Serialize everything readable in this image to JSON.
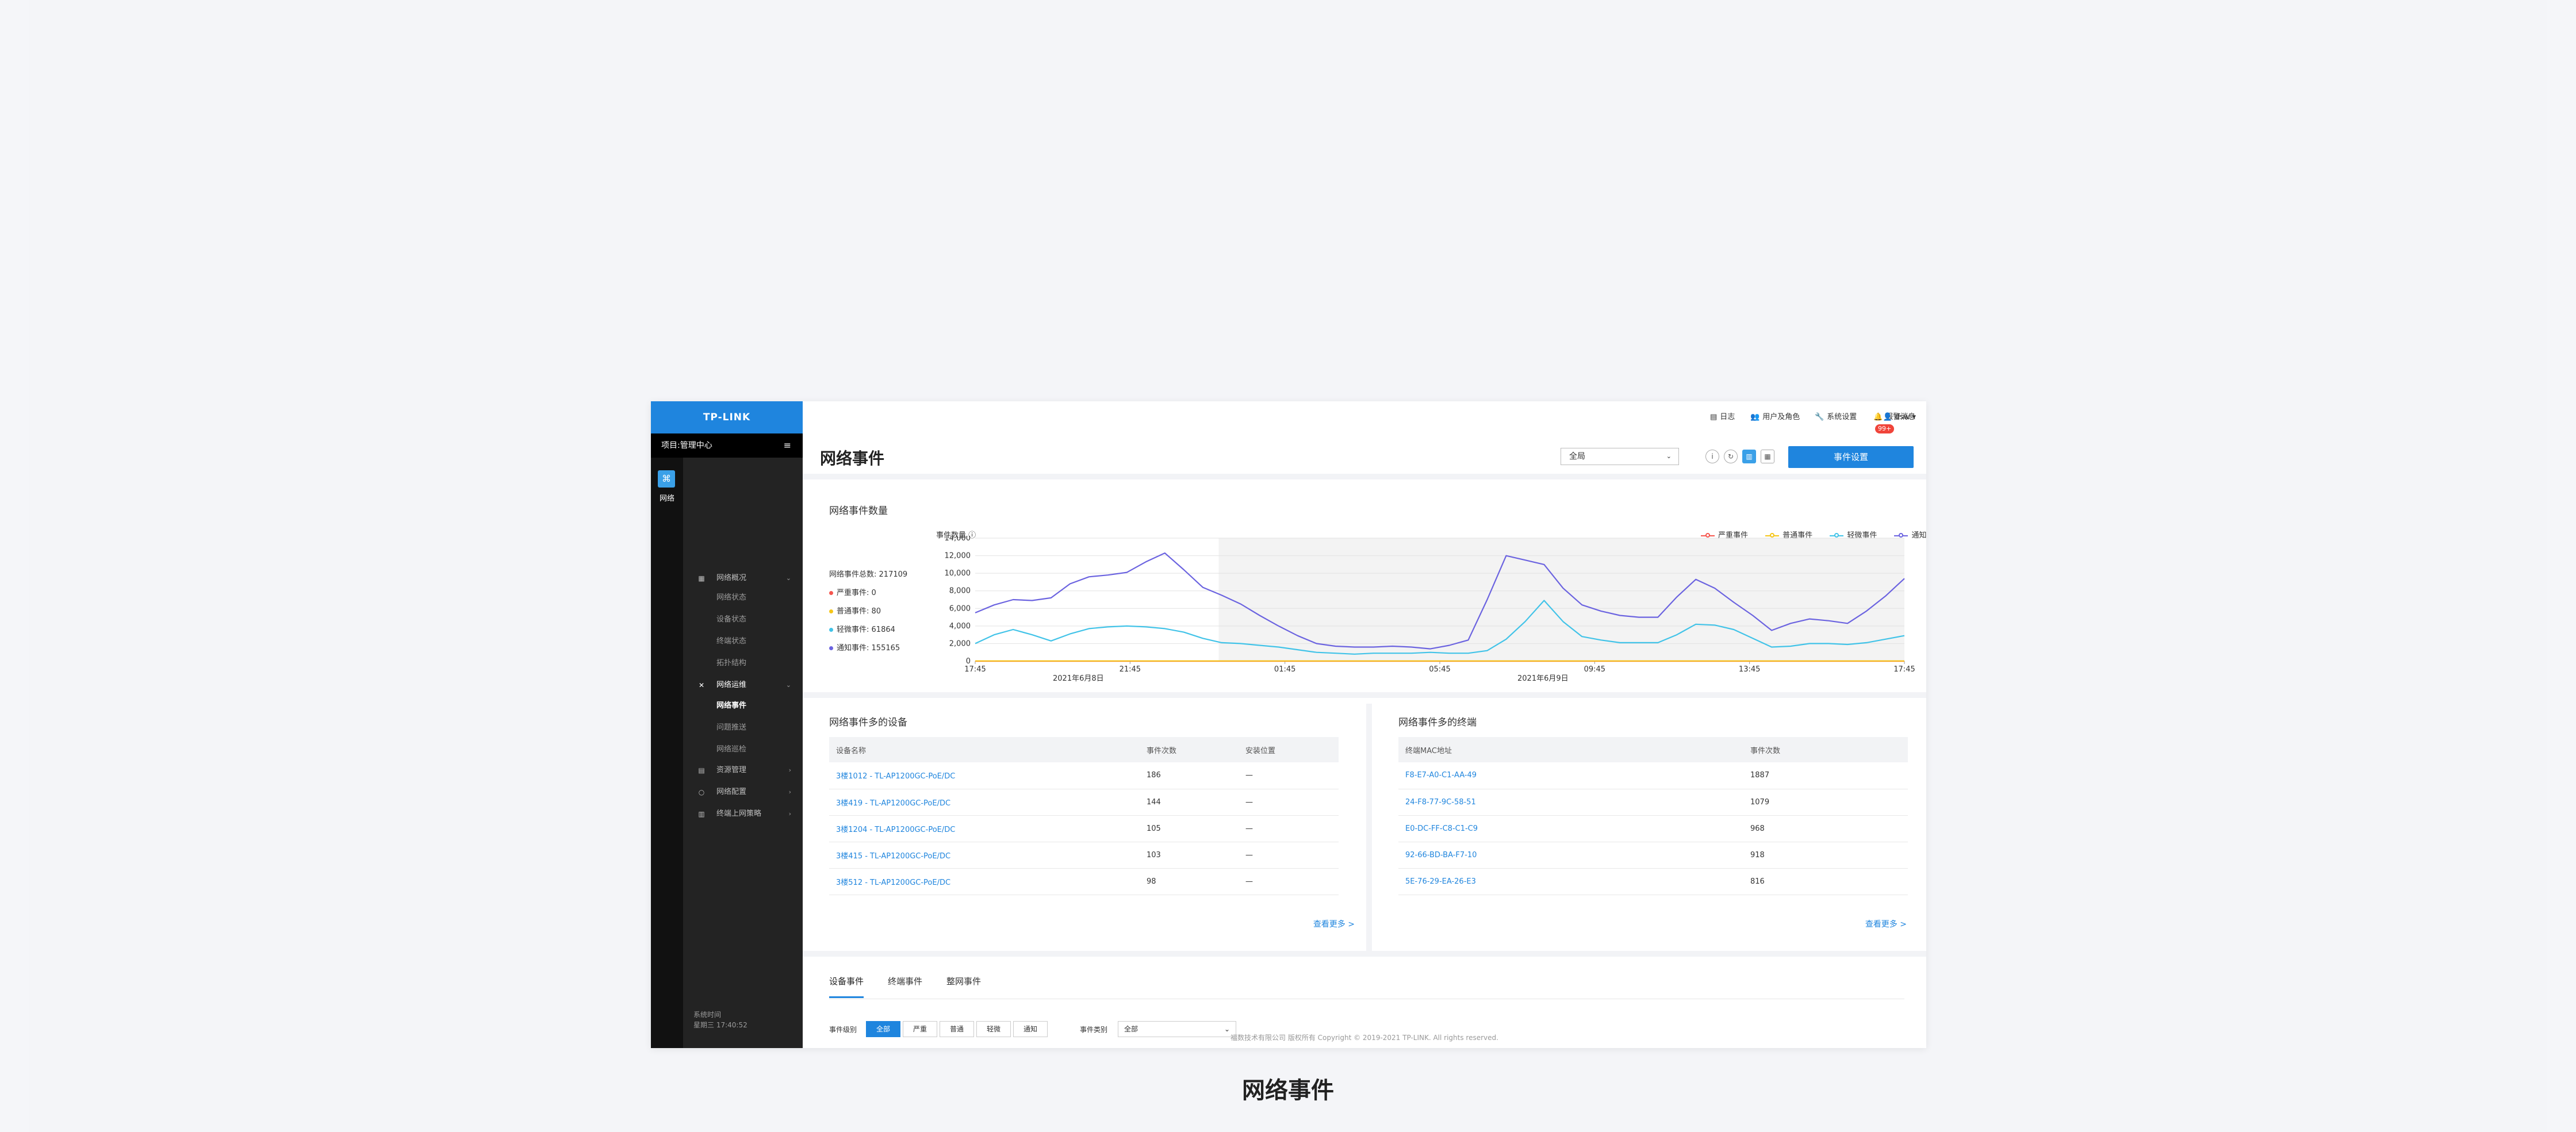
{
  "caption": "网络事件",
  "brand": "TP-LINK",
  "project": {
    "label": "项目:",
    "name": "管理中心"
  },
  "rail": {
    "net_label": "网络"
  },
  "nav": [
    {
      "label": "网络概况",
      "icon": "overview-icon",
      "chevron": "⌄"
    },
    {
      "label": "网络运维",
      "icon": "tools-icon",
      "chevron": "⌄"
    },
    {
      "label": "资源管理",
      "icon": "resource-icon",
      "chevron": "›"
    },
    {
      "label": "网络配置",
      "icon": "config-icon",
      "chevron": "›"
    },
    {
      "label": "终端上网策略",
      "icon": "policy-icon",
      "chevron": "›"
    }
  ],
  "subnav1": [
    "网络状态",
    "设备状态",
    "终端状态",
    "拓扑结构"
  ],
  "subnav2": [
    "网络事件",
    "问题推送",
    "网络巡检"
  ],
  "systime": {
    "label": "系统时间",
    "value": "星期三 17:40:52"
  },
  "top": {
    "log": "日志",
    "users": "用户及角色",
    "settings": "系统设置",
    "alerts": "报警消息",
    "badge": "99+",
    "user": "dsw"
  },
  "page": {
    "title": "网络事件",
    "scope": "全局",
    "event_settings": "事件设置"
  },
  "chart_section": {
    "title": "网络事件数量",
    "total_label": "网络事件总数:",
    "total": "217109",
    "severe_label": "严重事件:",
    "severe": "0",
    "normal_label": "普通事件:",
    "normal": "80",
    "minor_label": "轻微事件:",
    "minor": "61864",
    "notice_label": "通知事件:",
    "notice": "155165"
  },
  "chart_data": {
    "type": "line",
    "ylabel": "事件数量",
    "ylim": [
      0,
      14000
    ],
    "yticks": [
      "0",
      "2,000",
      "4,000",
      "6,000",
      "8,000",
      "10,000",
      "12,000",
      "14,000"
    ],
    "xticks": [
      "17:45",
      "21:45",
      "01:45",
      "05:45",
      "09:45",
      "13:45",
      "17:45"
    ],
    "xsub": [
      "",
      "2021年6月8日",
      "",
      "",
      "2021年6月9日",
      "",
      ""
    ],
    "series": [
      {
        "name": "严重事件",
        "color": "#f5564e",
        "values": [
          0,
          0,
          0,
          0,
          0,
          0,
          0,
          0,
          0,
          0,
          0,
          0,
          0,
          0,
          0,
          0,
          0,
          0,
          0,
          0,
          0,
          0,
          0,
          0,
          0,
          0,
          0,
          0,
          0,
          0,
          0,
          0,
          0,
          0,
          0,
          0,
          0,
          0,
          0,
          0,
          0,
          0,
          0,
          0,
          0,
          0,
          0,
          0,
          0,
          0
        ]
      },
      {
        "name": "普通事件",
        "color": "#f5c518",
        "values": [
          20,
          20,
          20,
          20,
          20,
          20,
          20,
          20,
          20,
          20,
          20,
          20,
          20,
          20,
          20,
          20,
          20,
          20,
          20,
          20,
          20,
          20,
          20,
          20,
          20,
          20,
          20,
          20,
          20,
          20,
          20,
          20,
          20,
          20,
          20,
          20,
          20,
          20,
          20,
          20,
          20,
          20,
          20,
          20,
          20,
          20,
          20,
          20,
          20,
          20
        ]
      },
      {
        "name": "轻微事件",
        "color": "#41c3e8",
        "values": [
          2000,
          3000,
          3600,
          3000,
          2300,
          3100,
          3700,
          3900,
          4000,
          3900,
          3700,
          3300,
          2600,
          2100,
          2000,
          1800,
          1600,
          1300,
          1000,
          900,
          800,
          900,
          900,
          900,
          1000,
          900,
          900,
          1200,
          2500,
          4500,
          6900,
          4500,
          2800,
          2400,
          2100,
          2100,
          2100,
          3000,
          4200,
          4100,
          3600,
          2600,
          1600,
          1700,
          2000,
          2000,
          1900,
          2100,
          2500,
          2900
        ]
      },
      {
        "name": "通知事件",
        "color": "#6b63e0",
        "values": [
          5500,
          6400,
          7000,
          6900,
          7200,
          8800,
          9600,
          9800,
          10100,
          11300,
          12300,
          10400,
          8400,
          7500,
          6500,
          5200,
          4000,
          2900,
          2000,
          1700,
          1600,
          1600,
          1700,
          1600,
          1400,
          1800,
          2400,
          7000,
          12000,
          11500,
          11000,
          8300,
          6400,
          5700,
          5200,
          5000,
          5000,
          7300,
          9300,
          8300,
          6700,
          5200,
          3500,
          4300,
          4800,
          4600,
          4300,
          5700,
          7400,
          9400
        ]
      }
    ],
    "grid": true,
    "legend": "top-right"
  },
  "devices": {
    "title": "网络事件多的设备",
    "headers": [
      "设备名称",
      "事件次数",
      "安装位置"
    ],
    "rows": [
      [
        "3楼1012 - TL-AP1200GC-PoE/DC",
        "186",
        "—"
      ],
      [
        "3楼419 - TL-AP1200GC-PoE/DC",
        "144",
        "—"
      ],
      [
        "3楼1204 - TL-AP1200GC-PoE/DC",
        "105",
        "—"
      ],
      [
        "3楼415 - TL-AP1200GC-PoE/DC",
        "103",
        "—"
      ],
      [
        "3楼512 - TL-AP1200GC-PoE/DC",
        "98",
        "—"
      ]
    ],
    "more": "查看更多 >"
  },
  "terminals": {
    "title": "网络事件多的终端",
    "headers": [
      "终端MAC地址",
      "事件次数"
    ],
    "rows": [
      [
        "F8-E7-A0-C1-AA-49",
        "1887"
      ],
      [
        "24-F8-77-9C-58-51",
        "1079"
      ],
      [
        "E0-DC-FF-C8-C1-C9",
        "968"
      ],
      [
        "92-66-BD-BA-F7-10",
        "918"
      ],
      [
        "5E-76-29-EA-26-E3",
        "816"
      ]
    ],
    "more": "查看更多 >"
  },
  "tabs": [
    "设备事件",
    "终端事件",
    "整网事件"
  ],
  "filter": {
    "level_label": "事件级别",
    "levels": [
      "全部",
      "严重",
      "普通",
      "轻微",
      "通知"
    ],
    "type_label": "事件类别",
    "type_value": "全部"
  },
  "footer": "福数技术有限公司 版权所有 Copyright © 2019-2021 TP-LINK. All rights reserved."
}
